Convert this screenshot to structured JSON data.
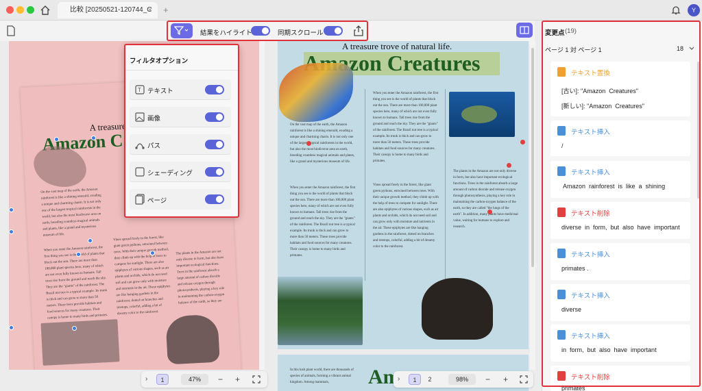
{
  "window": {
    "tab_title": "比較 [20250521-120744_C",
    "tab_close": "×",
    "new_tab": "+",
    "avatar": "Y"
  },
  "toolbar": {
    "highlight_label": "結果をハイライト",
    "scroll_label": "同期スクロール",
    "highlight_on": true,
    "scroll_on": true
  },
  "filter_popup": {
    "title": "フィルタオプション",
    "options": [
      {
        "label": "テキスト",
        "icon": "text-icon",
        "on": true
      },
      {
        "label": "画像",
        "icon": "image-icon",
        "on": true
      },
      {
        "label": "パス",
        "icon": "path-icon",
        "on": true
      },
      {
        "label": "シェーディング",
        "icon": "shading-icon",
        "on": true
      },
      {
        "label": "ページ",
        "icon": "page-icon",
        "on": true
      }
    ]
  },
  "left_doc": {
    "subtitle": "A treasure",
    "title": "Amazon C"
  },
  "right_doc": {
    "subtitle": "A treasure trove of natural life.",
    "title": "Amazon Creatures",
    "col1a": "On the vast map of the earth, the Amazon rainforest is like a shining emerald, exuding a unique and charming charm. It is not only one of the largest tropical rainforests in the world, but also the most biodiverse area on earth, breeding countless magical animals and plants, like a grand and mysterious museum of life.",
    "col2a": "When you enter the Amazon rainforest, the first thing you see is the world of plants that block out the sun. There are more than 100,000 plant species here, many of which are not even fully known to humans. Tall trees rise from the ground and reach the sky. They are the \"giants\" of the rainforest. The Brazil nut tree is a typical example. Its trunk is thick and can grow to more than 50 meters. These trees provide habitats and food sources for many creatures. Their canopy is home to many birds and primates.",
    "col1b": "When you enter the Amazon rainforest, the first thing you see is the world of plants that block out the sun. There are more than 100,000 plant species here, many of which are not even fully known to humans. Tall trees rise from the ground and reach the sky. They are the \"giants\" of the rainforest. The Brazil nut tree is a typical example. Its trunk is thick and can grow to more than 50 meters. These trees provide habitats and food sources for many creatures. Their canopy is home to many birds and primates.",
    "col2b": "Vines spread freely in the forest, like giant green pythons, entwined between trees. With their unique growth method, they climb up with the help of trees to compete for sunlight. There are also epiphytes of various shapes, such as air plants and orchids, which do not need soil and can grow only with moisture and nutrients in the air. These epiphytes are like hanging gardens in the rainforest, dotted on branches and treetops, colorful, adding a bit of dreamy color to the rainforest.",
    "col3b": "The plants in the Amazon are not only diverse in form, but also have important ecological functions. Trees in the rainforest absorb a large amount of carbon dioxide and release oxygen through photosynthesis, playing a key role in maintaining the carbon-oxygen balance of the earth, so they are called \"the lungs of the earth\". In addition, many plants have medicinal value, waiting for humans to explore and research.",
    "bottom_text": "In this lush plant world, there are thousands of species of animals, forming a vibrant animal kingdom. Among mammals,",
    "bottom_title": "Am"
  },
  "left_bar": {
    "page": "1",
    "zoom": "47%",
    "minus": "−",
    "plus": "+",
    "chev": "›"
  },
  "right_bar": {
    "page1": "1",
    "page2": "2",
    "zoom": "98%",
    "minus": "−",
    "plus": "+",
    "chev": "›"
  },
  "changes": {
    "header": "変更点",
    "count": "(19)",
    "page_label": "ページ 1 対 ページ 1",
    "page_count": "18",
    "items": [
      {
        "type": "テキスト置換",
        "kind": "replace",
        "lines": [
          "[古い]: \"Amazon  Creatures\"",
          "[新しい]: \"Amazon  Creatures\""
        ]
      },
      {
        "type": "テキスト挿入",
        "kind": "insert",
        "lines": [
          "/"
        ]
      },
      {
        "type": "テキスト挿入",
        "kind": "insert",
        "lines": [
          " Amazon  rainforest  is  like  a  shining"
        ]
      },
      {
        "type": "テキスト削除",
        "kind": "delete",
        "lines": [
          "diverse  in  form,  but  also  have  important"
        ]
      },
      {
        "type": "テキスト挿入",
        "kind": "insert",
        "lines": [
          "primates ."
        ]
      },
      {
        "type": "テキスト挿入",
        "kind": "insert",
        "lines": [
          "diverse"
        ]
      },
      {
        "type": "テキスト挿入",
        "kind": "insert",
        "lines": [
          "in  form,  but  also  have  important"
        ]
      },
      {
        "type": "テキスト削除",
        "kind": "delete",
        "lines": [
          "primates"
        ]
      }
    ]
  },
  "colors": {
    "accent": "#5a63d8",
    "highlight": "#e0303a",
    "replace": "#f0a030",
    "insert": "#4a90d8",
    "delete": "#e04040"
  }
}
